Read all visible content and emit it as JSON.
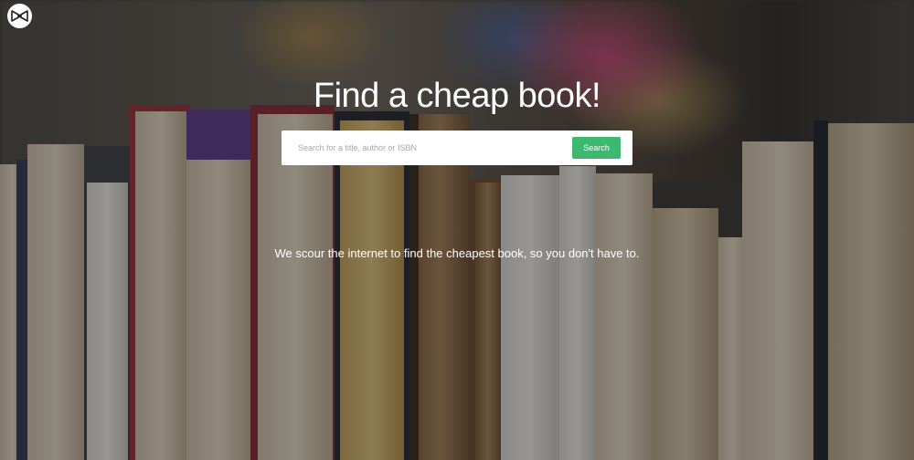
{
  "brand": {
    "logo_icon": "bowtie-logo-icon"
  },
  "hero": {
    "headline": "Find a cheap book!",
    "tagline": "We scour the internet to find the cheapest book, so you don't have to."
  },
  "search": {
    "placeholder": "Search for a title, author or ISBN",
    "value": "",
    "button_label": "Search"
  },
  "colors": {
    "accent": "#3cb96f",
    "text_on_image": "#ffffff"
  }
}
